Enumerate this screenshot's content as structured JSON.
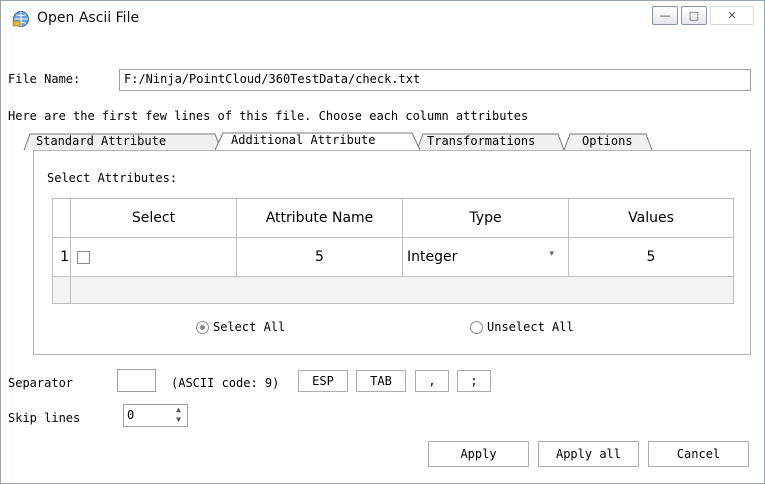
{
  "window": {
    "title": "Open Ascii File",
    "icon": "app-globe-icon",
    "controls": {
      "minimize": "—",
      "maximize": "□",
      "close": "✕"
    }
  },
  "file": {
    "label": "File Name:",
    "value": "F:/Ninja/PointCloud/360TestData/check.txt"
  },
  "instructions": "Here are the first few lines of this file. Choose each column attributes",
  "tabs": [
    {
      "label": "Standard Attribute",
      "active": false
    },
    {
      "label": "Additional Attribute",
      "active": true
    },
    {
      "label": "Transformations",
      "active": false
    },
    {
      "label": "Options",
      "active": false
    }
  ],
  "attributes": {
    "label": "Select Attributes:",
    "columns": [
      "Select",
      "Attribute Name",
      "Type",
      "Values"
    ],
    "rows": [
      {
        "index": "1",
        "checked": false,
        "name": "5",
        "type": "Integer",
        "value": "5"
      }
    ],
    "select_all": "Select All",
    "unselect_all": "Unselect All",
    "selected_option": "select_all"
  },
  "separator": {
    "label": "Separator",
    "value": "",
    "ascii_code": "(ASCII code: 9)",
    "buttons": [
      "ESP",
      "TAB",
      ",",
      ";"
    ]
  },
  "skip_lines": {
    "label": "Skip lines",
    "value": "0"
  },
  "actions": {
    "apply": "Apply",
    "apply_all": "Apply all",
    "cancel": "Cancel"
  }
}
